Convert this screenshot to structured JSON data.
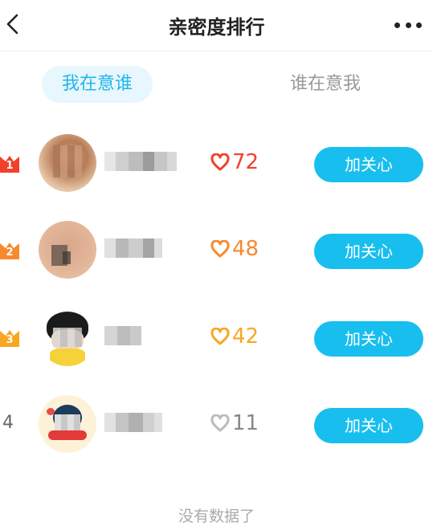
{
  "header": {
    "title": "亲密度排行",
    "back_icon": "chevron-left-icon",
    "more_icon": "more-dots-icon"
  },
  "tabs": [
    {
      "label": "我在意谁",
      "active": true
    },
    {
      "label": "谁在意我",
      "active": false
    }
  ],
  "colors": {
    "accent": "#18bfee",
    "rank1": "#f2402b",
    "rank2": "#f78a2d",
    "rank3": "#f9a623",
    "heart_gray": "#bbbbbb"
  },
  "rows": [
    {
      "rank": "1",
      "score": "72",
      "button": "加关心",
      "heart_color": "#f2402b"
    },
    {
      "rank": "2",
      "score": "48",
      "button": "加关心",
      "heart_color": "#f78a2d"
    },
    {
      "rank": "3",
      "score": "42",
      "button": "加关心",
      "heart_color": "#f9a623"
    },
    {
      "rank": "4",
      "score": "11",
      "button": "加关心",
      "heart_color": "#bbbbbb"
    }
  ],
  "footer": {
    "text": "没有数据了"
  }
}
